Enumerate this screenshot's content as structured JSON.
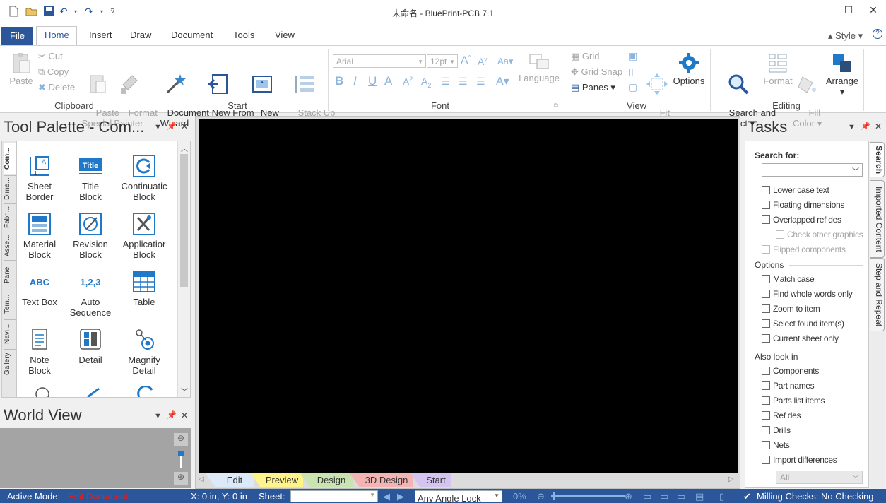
{
  "window": {
    "title": "未命名 - BluePrint-PCB 7.1"
  },
  "tabs": {
    "file": "File",
    "home": "Home",
    "insert": "Insert",
    "draw": "Draw",
    "document": "Document",
    "tools": "Tools",
    "view": "View",
    "style": "Style"
  },
  "clipboard": {
    "paste": "Paste",
    "cut": "Cut",
    "copy": "Copy",
    "delete": "Delete",
    "paste_special": "Paste\nSpecial",
    "format_painter": "Format\nPainter",
    "label": "Clipboard"
  },
  "start": {
    "wizard": "Document\nWizard",
    "new_import": "New From\nImport",
    "new_drawing": "New\nDrawing",
    "stackup": "Stack Up\nVisualizer",
    "label": "Start"
  },
  "font": {
    "name": "Arial",
    "size": "12pt",
    "language": "Language",
    "label": "Font"
  },
  "view": {
    "grid": "Grid",
    "grid_snap": "Grid Snap",
    "panes": "Panes",
    "fit_sheet": "Fit\nSheet",
    "options": "Options",
    "label": "View"
  },
  "editing": {
    "search_select": "Search and\nSelect",
    "format": "Format",
    "fill_color": "Fill\nColor",
    "arrange": "Arrange",
    "label": "Editing"
  },
  "palette": {
    "title": "Tool Palette - Com...",
    "vtabs": [
      "Com...",
      "Dime...",
      "Fabri...",
      "Asse...",
      "Panel",
      "Tem...",
      "Navi...",
      "Gallery"
    ],
    "tools": [
      {
        "label": "Sheet\nBorder"
      },
      {
        "label": "Title\nBlock"
      },
      {
        "label": "Continuatic\nBlock"
      },
      {
        "label": "Material\nBlock"
      },
      {
        "label": "Revision\nBlock"
      },
      {
        "label": "Applicatior\nBlock"
      },
      {
        "label": "Text Box"
      },
      {
        "label": "Auto\nSequence"
      },
      {
        "label": "Table"
      },
      {
        "label": "Note\nBlock"
      },
      {
        "label": "Detail"
      },
      {
        "label": "Magnify\nDetail"
      }
    ],
    "title_icon_text": "Title",
    "abc_text": "ABC",
    "seq_text": "1,2,3"
  },
  "world_view": {
    "title": "World View"
  },
  "bottom_tabs": [
    "Edit",
    "Preview",
    "Design",
    "3D Design",
    "Start"
  ],
  "tasks": {
    "title": "Tasks",
    "search_for": "Search for:",
    "search_opts": [
      {
        "label": "Lower case text",
        "enabled": true
      },
      {
        "label": "Floating dimensions",
        "enabled": true
      },
      {
        "label": "Overlapped ref des",
        "enabled": true
      },
      {
        "label": "Check other graphics",
        "enabled": false
      },
      {
        "label": "Flipped components",
        "enabled": false
      }
    ],
    "options_label": "Options",
    "options": [
      "Match case",
      "Find whole words only",
      "Zoom to item",
      "Select found item(s)",
      "Current sheet only"
    ],
    "also_label": "Also look in",
    "also": [
      "Components",
      "Part names",
      "Parts list items",
      "Ref des",
      "Drills",
      "Nets",
      "Import differences"
    ],
    "all_value": "All",
    "vtabs": [
      "Search",
      "Imported Content",
      "Step and Repeat"
    ]
  },
  "status": {
    "active_mode_label": "Active Mode:",
    "active_mode": "Edit Document",
    "coords": "X: 0 in, Y: 0 in",
    "sheet_label": "Sheet:",
    "angle_lock": "Any Angle Lock",
    "zoom": "0%",
    "milling": "Milling Checks: No Checking"
  }
}
